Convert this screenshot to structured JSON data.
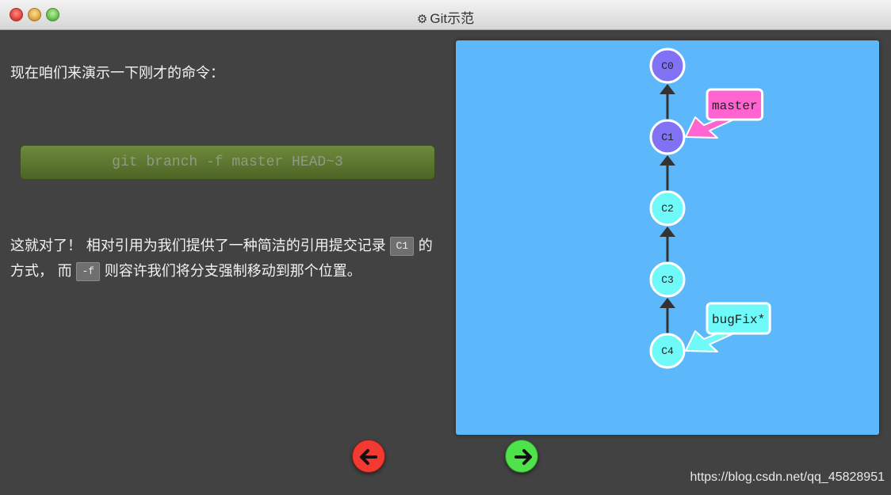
{
  "window": {
    "title": "Git示范",
    "title_icon": "gear-icon"
  },
  "lesson": {
    "intro": "现在咱们来演示一下刚才的命令：",
    "command": "git branch -f master HEAD~3",
    "explain_part1": "这就对了！ 相对引用为我们提供了一种简洁的引用提交记录 ",
    "chip_c1": "C1",
    "explain_part2": " 的方式， 而 ",
    "chip_f": "-f",
    "explain_part3": " 则容许我们将分支强制移动到那个位置。"
  },
  "graph": {
    "background": "#5cb8fb",
    "commits": [
      {
        "id": "C0",
        "color": "#8171f5"
      },
      {
        "id": "C1",
        "color": "#8171f5"
      },
      {
        "id": "C2",
        "color": "#6ff9f9"
      },
      {
        "id": "C3",
        "color": "#6ff9f9"
      },
      {
        "id": "C4",
        "color": "#6ff9f9"
      }
    ],
    "branches": [
      {
        "name": "master",
        "target": "C1",
        "color": "#ff64d0"
      },
      {
        "name": "bugFix*",
        "target": "C4",
        "color": "#6ff9f9"
      }
    ]
  },
  "nav": {
    "back_icon": "arrow-left-icon",
    "back_color": "#f23a32",
    "next_icon": "arrow-right-icon",
    "next_color": "#4fe24a"
  },
  "watermark": "https://blog.csdn.net/qq_45828951"
}
